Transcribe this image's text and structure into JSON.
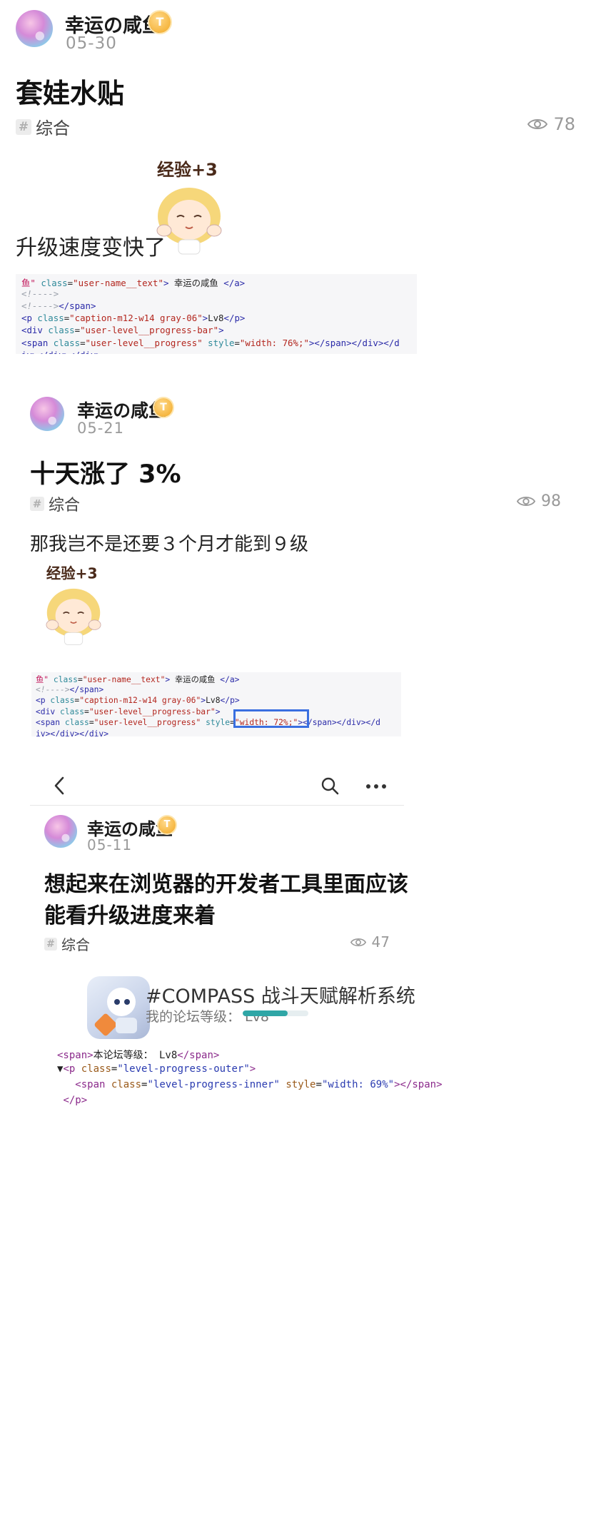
{
  "post1": {
    "username": "幸运の咸鱼",
    "badge": "T",
    "date": "05-30",
    "title": "套娃水贴",
    "tag": "综合",
    "views": "78",
    "text": "升级速度变快了",
    "sticker_text": "经验+3",
    "code_lines": [
      [
        [
          "c-red",
          "鱼\""
        ],
        [
          "c-dark",
          " "
        ],
        [
          "c-teal",
          "class"
        ],
        [
          "c-dark",
          "="
        ],
        [
          "c-str",
          "\"user-name__text\""
        ],
        [
          "c-blue",
          ">"
        ],
        [
          "c-dark",
          " 幸运の咸鱼 "
        ],
        [
          "c-blue",
          "</a>"
        ]
      ],
      [
        [
          "c-gray",
          "<!---->"
        ]
      ],
      [
        [
          "c-gray",
          "<!---->"
        ],
        [
          "c-blue",
          "</span>"
        ]
      ],
      [
        [
          "c-blue",
          "<p "
        ],
        [
          "c-teal",
          "class"
        ],
        [
          "c-dark",
          "="
        ],
        [
          "c-str",
          "\"caption-m12-w14 gray-06\""
        ],
        [
          "c-blue",
          ">"
        ],
        [
          "c-dark",
          "Lv8"
        ],
        [
          "c-blue",
          "</p>"
        ]
      ],
      [
        [
          "c-blue",
          "<div "
        ],
        [
          "c-teal",
          "class"
        ],
        [
          "c-dark",
          "="
        ],
        [
          "c-str",
          "\"user-level__progress-bar\""
        ],
        [
          "c-blue",
          ">"
        ]
      ],
      [
        [
          "c-blue",
          "<span "
        ],
        [
          "c-teal",
          "class"
        ],
        [
          "c-dark",
          "="
        ],
        [
          "c-str",
          "\"user-level__progress\""
        ],
        [
          "c-dark",
          " "
        ],
        [
          "c-teal",
          "style"
        ],
        [
          "c-dark",
          "="
        ],
        [
          "c-str",
          "\"width: 76%;\""
        ],
        [
          "c-blue",
          "></span></div></d"
        ]
      ],
      [
        [
          "c-blue",
          "iv></div></div>"
        ]
      ]
    ]
  },
  "post2": {
    "username": "幸运の咸鱼",
    "badge": "T",
    "date": "05-21",
    "title": "十天涨了 3%",
    "tag": "综合",
    "views": "98",
    "text": "那我岂不是还要３个月才能到９级",
    "sticker_text": "经验+3",
    "code_lines": [
      [
        [
          "c-red",
          "鱼\""
        ],
        [
          "c-dark",
          " "
        ],
        [
          "c-teal",
          "class"
        ],
        [
          "c-dark",
          "="
        ],
        [
          "c-str",
          "\"user-name__text\""
        ],
        [
          "c-blue",
          ">"
        ],
        [
          "c-dark",
          " 幸运の咸鱼 "
        ],
        [
          "c-blue",
          "</a>"
        ]
      ],
      [
        [
          "c-gray",
          "<!---->"
        ],
        [
          "c-blue",
          "</span>"
        ]
      ],
      [
        [
          "c-blue",
          "<p "
        ],
        [
          "c-teal",
          "class"
        ],
        [
          "c-dark",
          "="
        ],
        [
          "c-str",
          "\"caption-m12-w14 gray-06\""
        ],
        [
          "c-blue",
          ">"
        ],
        [
          "c-dark",
          "Lv8"
        ],
        [
          "c-blue",
          "</p>"
        ]
      ],
      [
        [
          "c-blue",
          "<div "
        ],
        [
          "c-teal",
          "class"
        ],
        [
          "c-dark",
          "="
        ],
        [
          "c-str",
          "\"user-level__progress-bar\""
        ],
        [
          "c-blue",
          ">"
        ]
      ],
      [
        [
          "c-blue",
          "<span "
        ],
        [
          "c-teal",
          "class"
        ],
        [
          "c-dark",
          "="
        ],
        [
          "c-str",
          "\"user-level__progress\""
        ],
        [
          "c-dark",
          " "
        ],
        [
          "c-teal",
          "style"
        ],
        [
          "c-dark",
          "="
        ],
        [
          "c-str",
          "\"width: 72%;\""
        ],
        [
          "c-blue",
          "></span></div></d"
        ]
      ],
      [
        [
          "c-blue",
          "iv></div></div>"
        ]
      ]
    ]
  },
  "post3": {
    "username": "幸运の咸鱼",
    "badge": "T",
    "date": "05-11",
    "title_line1": "想起来在浏览器的开发者工具里面应该",
    "title_line2": "能看升级进度来着",
    "tag": "综合",
    "views": "47",
    "app_title": "#COMPASS 战斗天赋解析系统",
    "app_sub": "我的论坛等级： Lv8",
    "level_progress": 0.69,
    "devtools_lines": [
      [
        [
          "dt-tag",
          "<span>"
        ],
        [
          "c-dark",
          "本论坛等级： Lv8"
        ],
        [
          "dt-tag",
          "</span>"
        ]
      ],
      [
        [
          "c-dark",
          "▼"
        ],
        [
          "dt-tag",
          "<p "
        ],
        [
          "dt-attr",
          "class"
        ],
        [
          "c-dark",
          "="
        ],
        [
          "dt-val",
          "\"level-progress-outer\""
        ],
        [
          "dt-tag",
          ">"
        ]
      ],
      [
        [
          "c-dark",
          "   "
        ],
        [
          "dt-tag",
          "<span "
        ],
        [
          "dt-attr",
          "class"
        ],
        [
          "c-dark",
          "="
        ],
        [
          "dt-val",
          "\"level-progress-inner\""
        ],
        [
          "c-dark",
          " "
        ],
        [
          "dt-attr",
          "style"
        ],
        [
          "c-dark",
          "="
        ],
        [
          "dt-val",
          "\"width: 69%\""
        ],
        [
          "dt-tag",
          "></span>"
        ]
      ],
      [
        [
          "c-dark",
          " "
        ],
        [
          "dt-tag",
          "</p>"
        ]
      ]
    ]
  },
  "nav": {
    "back_icon": "chevron-left-icon",
    "search_icon": "search-icon",
    "more_icon": "more-icon"
  },
  "colors": {
    "accent_teal": "#2fa6a6",
    "highlight_blue": "#3a6fe0",
    "badge_gold": "#f2a822"
  }
}
